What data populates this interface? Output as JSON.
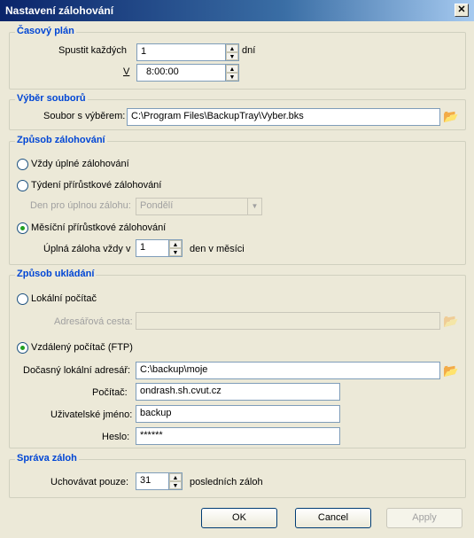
{
  "window": {
    "title": "Nastavení zálohování",
    "close_glyph": "✕"
  },
  "schedule": {
    "legend": "Časový plán",
    "every_label": "Spustit každých",
    "every_value": "1",
    "every_unit": "dní",
    "at_label": "V",
    "at_value": "8:00:00"
  },
  "file_selection": {
    "legend": "Výběr souborů",
    "file_label": "Soubor s výběrem:",
    "file_value": "C:\\Program Files\\BackupTray\\Vyber.bks",
    "browse_icon": "folder-open-icon"
  },
  "method": {
    "legend": "Způsob zálohování",
    "opt_full": "Vždy úplné zálohování",
    "opt_weekly": "Týdení přírůstkové zálohování",
    "day_label": "Den pro úplnou zálohu:",
    "day_value": "Pondělí",
    "opt_monthly": "Měsíční přírůstkové zálohování",
    "monthly_label": "Úplná záloha vždy v",
    "monthly_value": "1",
    "monthly_suffix": "den v měsíci",
    "selected": "monthly"
  },
  "storage": {
    "legend": "Způsob ukládání",
    "opt_local": "Lokální počítač",
    "path_label": "Adresářová cesta:",
    "path_value": "",
    "opt_remote": "Vzdálený počítač (FTP)",
    "temp_label": "Dočasný lokální adresář:",
    "temp_value": "C:\\backup\\moje",
    "host_label": "Počítač:",
    "host_value": "ondrash.sh.cvut.cz",
    "user_label": "Uživatelské jméno:",
    "user_value": "backup",
    "pass_label": "Heslo:",
    "pass_value": "******",
    "selected": "remote"
  },
  "retention": {
    "legend": "Správa záloh",
    "keep_label": "Uchovávat pouze:",
    "keep_value": "31",
    "keep_suffix": "posledních záloh"
  },
  "buttons": {
    "ok": "OK",
    "cancel": "Cancel",
    "apply": "Apply"
  }
}
